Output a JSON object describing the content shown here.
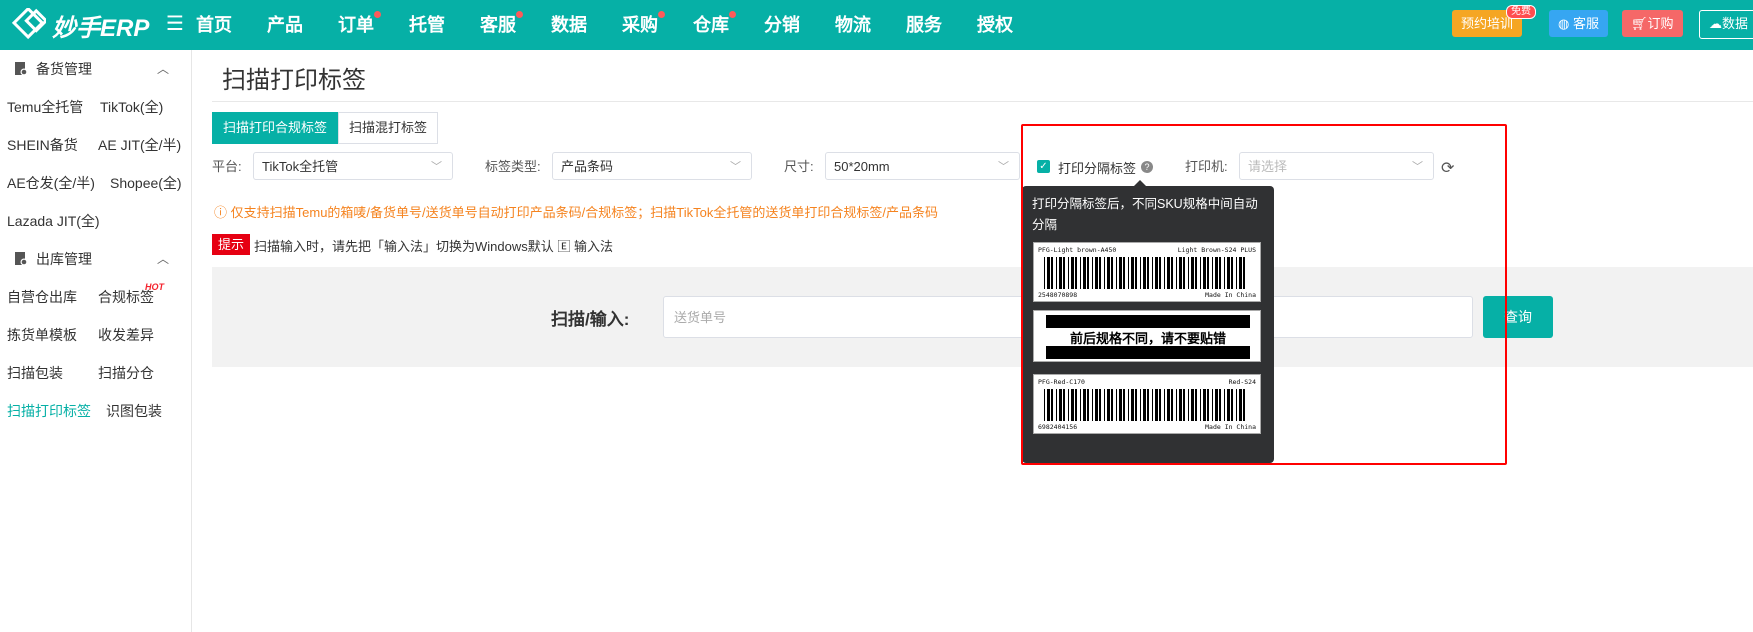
{
  "brand": {
    "name": "妙手ERP"
  },
  "nav": {
    "items": [
      {
        "label": "首页",
        "dot": false
      },
      {
        "label": "产品",
        "dot": false
      },
      {
        "label": "订单",
        "dot": true
      },
      {
        "label": "托管",
        "dot": false
      },
      {
        "label": "客服",
        "dot": true
      },
      {
        "label": "数据",
        "dot": false
      },
      {
        "label": "采购",
        "dot": true
      },
      {
        "label": "仓库",
        "dot": true
      },
      {
        "label": "分销",
        "dot": false
      },
      {
        "label": "物流",
        "dot": false
      },
      {
        "label": "服务",
        "dot": false
      },
      {
        "label": "授权",
        "dot": false
      }
    ],
    "train_label": "预约培训",
    "free_badge": "免费",
    "service_label": "客服",
    "order_label": "订购",
    "data_label": "数据"
  },
  "sidebar": {
    "group1": {
      "label": "备货管理"
    },
    "group1_items": [
      "Temu全托管",
      "TikTok(全)",
      "SHEIN备货",
      "AE JIT(全/半)",
      "AE仓发(全/半)",
      "Shopee(全)",
      "Lazada JIT(全)"
    ],
    "group2": {
      "label": "出库管理"
    },
    "group2_items": [
      "自营仓出库",
      "合规标签",
      "拣货单模板",
      "收发差异",
      "扫描包装",
      "扫描分仓",
      "扫描打印标签",
      "识图包装"
    ],
    "hot_badge": "HOT"
  },
  "main": {
    "title": "扫描打印标签",
    "tabs": [
      "扫描打印合规标签",
      "扫描混打标签"
    ],
    "platform_label": "平台:",
    "platform_value": "TikTok全托管",
    "label_type_label": "标签类型:",
    "label_type_value": "产品条码",
    "size_label": "尺寸:",
    "size_value": "50*20mm",
    "print_sep_label": "打印分隔标签",
    "printer_label": "打印机:",
    "printer_placeholder": "请选择",
    "warning": "仅支持扫描Temu的箱唛/备货单号/送货单号自动打印产品条码/合规标签；扫描TikTok全托管的送货单打印合规标签/产品条码",
    "tip_tag": "提示",
    "tip_text": "扫描输入时，请先把「输入法」切换为Windows默认 🄴 输入法",
    "scan_label": "扫描/输入:",
    "scan_placeholder": "送货单号",
    "query_button": "查询"
  },
  "tooltip": {
    "text": "打印分隔标签后，不同SKU规格中间自动分隔",
    "label1_left": "PFG-Light brown-A450",
    "label1_right": "Light Brown-S24 PLUS",
    "label1_code": "2548070898",
    "label1_origin": "Made In China",
    "separator_text": "前后规格不同，请不要贴错",
    "label2_left": "PFG-Red-C170",
    "label2_right": "Red-S24",
    "label2_code": "6982404156",
    "label2_origin": "Made In China"
  }
}
